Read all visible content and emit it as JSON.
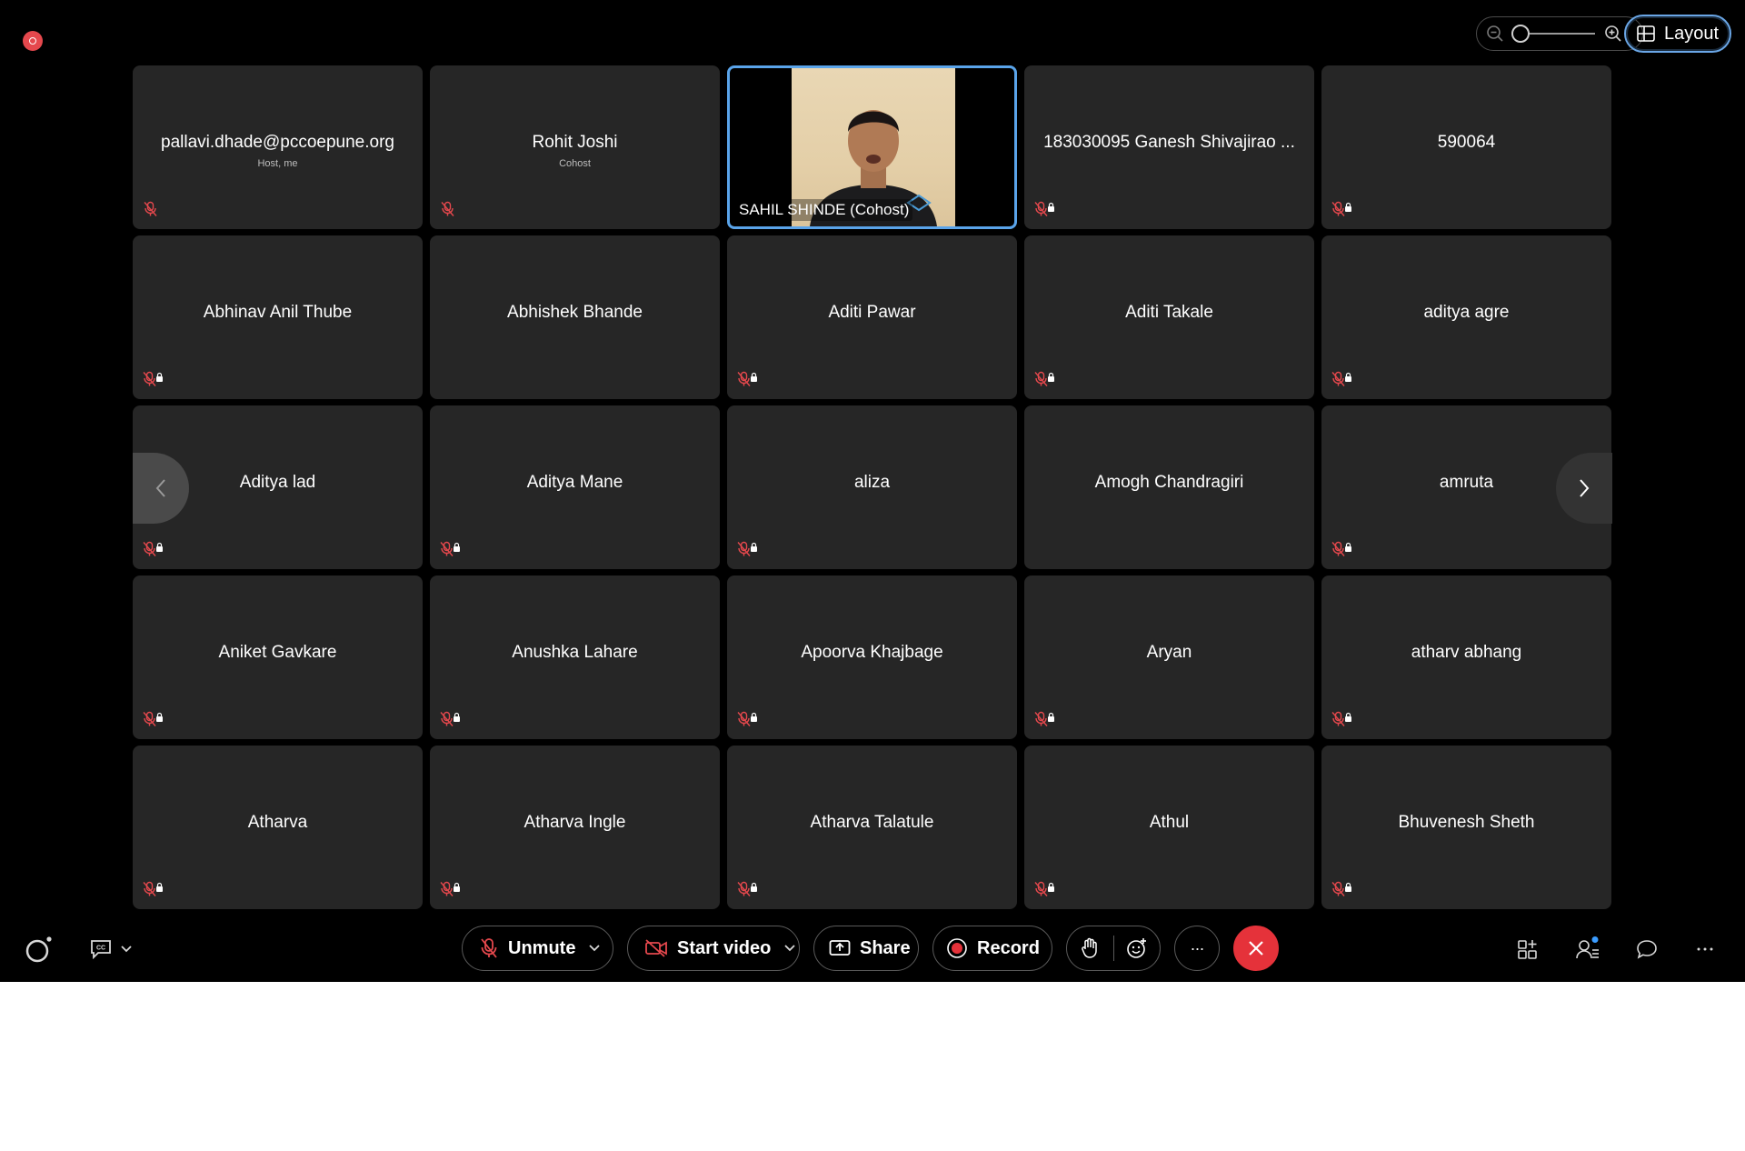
{
  "top_bar": {
    "layout_label": "Layout"
  },
  "participants": [
    {
      "name": "pallavi.dhade@pccoepune.org",
      "role": "Host, me",
      "mic": "muted"
    },
    {
      "name": "Rohit Joshi",
      "role": "Cohost",
      "mic": "muted"
    },
    {
      "name": "SAHIL SHINDE (Cohost)",
      "role": "",
      "mic": "video",
      "video": true
    },
    {
      "name": "183030095 Ganesh Shivajirao ...",
      "role": "",
      "mic": "locked"
    },
    {
      "name": "590064",
      "role": "",
      "mic": "locked"
    },
    {
      "name": "Abhinav Anil Thube",
      "role": "",
      "mic": "locked"
    },
    {
      "name": "Abhishek Bhande",
      "role": "",
      "mic": "none"
    },
    {
      "name": "Aditi Pawar",
      "role": "",
      "mic": "locked"
    },
    {
      "name": "Aditi Takale",
      "role": "",
      "mic": "locked"
    },
    {
      "name": "aditya agre",
      "role": "",
      "mic": "locked"
    },
    {
      "name": "Aditya lad",
      "role": "",
      "mic": "locked"
    },
    {
      "name": "Aditya Mane",
      "role": "",
      "mic": "locked"
    },
    {
      "name": "aliza",
      "role": "",
      "mic": "locked"
    },
    {
      "name": "Amogh Chandragiri",
      "role": "",
      "mic": "none"
    },
    {
      "name": "amruta",
      "role": "",
      "mic": "locked"
    },
    {
      "name": "Aniket Gavkare",
      "role": "",
      "mic": "locked"
    },
    {
      "name": "Anushka Lahare",
      "role": "",
      "mic": "locked"
    },
    {
      "name": "Apoorva Khajbage",
      "role": "",
      "mic": "locked"
    },
    {
      "name": "Aryan",
      "role": "",
      "mic": "locked"
    },
    {
      "name": "atharv abhang",
      "role": "",
      "mic": "locked"
    },
    {
      "name": "Atharva",
      "role": "",
      "mic": "locked"
    },
    {
      "name": "Atharva Ingle",
      "role": "",
      "mic": "locked"
    },
    {
      "name": "Atharva Talatule",
      "role": "",
      "mic": "locked"
    },
    {
      "name": "Athul",
      "role": "",
      "mic": "locked"
    },
    {
      "name": "Bhuvenesh Sheth",
      "role": "",
      "mic": "locked"
    }
  ],
  "toolbar": {
    "unmute_label": "Unmute",
    "start_video_label": "Start video",
    "share_label": "Share",
    "record_label": "Record",
    "more_label": "···"
  },
  "colors": {
    "background": "#000000",
    "tile": "#262626",
    "active_speaker_border": "#5aa4ea",
    "end_call": "#e5323a",
    "muted_icon": "#e5484d",
    "notification_dot": "#3b9cff"
  }
}
